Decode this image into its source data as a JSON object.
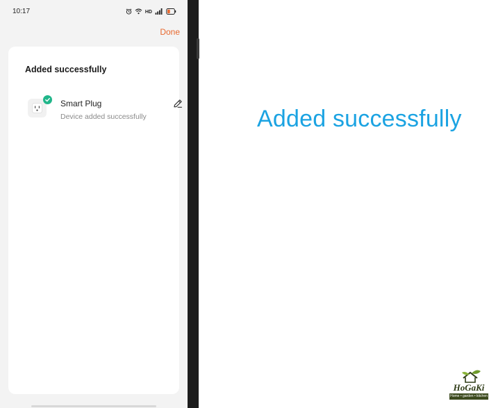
{
  "status_bar": {
    "time": "10:17",
    "network_label": "HD",
    "icons": [
      "alarm-icon",
      "wifi-icon",
      "signal-icon",
      "battery-icon"
    ]
  },
  "header": {
    "done_label": "Done",
    "done_color": "#e8682e"
  },
  "card": {
    "title": "Added successfully",
    "device": {
      "name": "Smart Plug",
      "status": "Device added successfully",
      "icon": "smart-plug-icon",
      "badge_icon": "check-icon",
      "badge_color": "#21b68a",
      "edit_icon": "pencil-icon"
    }
  },
  "caption": {
    "text": "Added successfully",
    "color": "#1ba3e2"
  },
  "watermark": {
    "brand": "HoGaKi",
    "tagline": "Home • garden • kitchen"
  }
}
